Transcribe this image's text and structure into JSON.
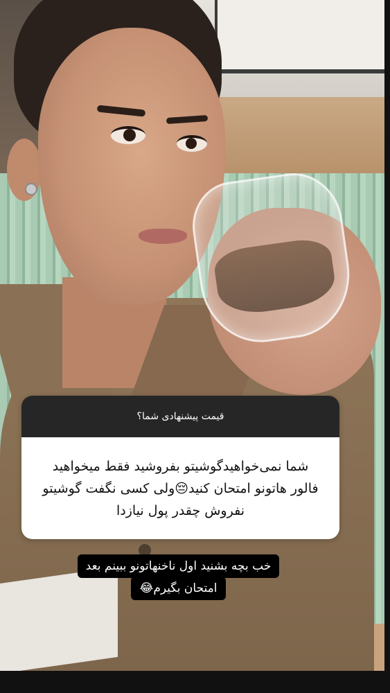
{
  "question_sticker": {
    "prompt": "قیمت پیشنهادی شما؟",
    "response": "شما نمی‌خواهیدگوشیتو بفروشید فقط میخواهید فالور هاتونو امتحان کنید😔ولی کسی نگفت گوشیتو نفروش چقدر پول نیازدا"
  },
  "caption": {
    "line1": "خب بچه بشنید اول ناخنهاتونو ببینم بعد",
    "line2": "امتحان بگیرم😂"
  },
  "colors": {
    "sticker_header": "#262626",
    "sticker_body": "#ffffff",
    "caption_bg": "#000000"
  }
}
